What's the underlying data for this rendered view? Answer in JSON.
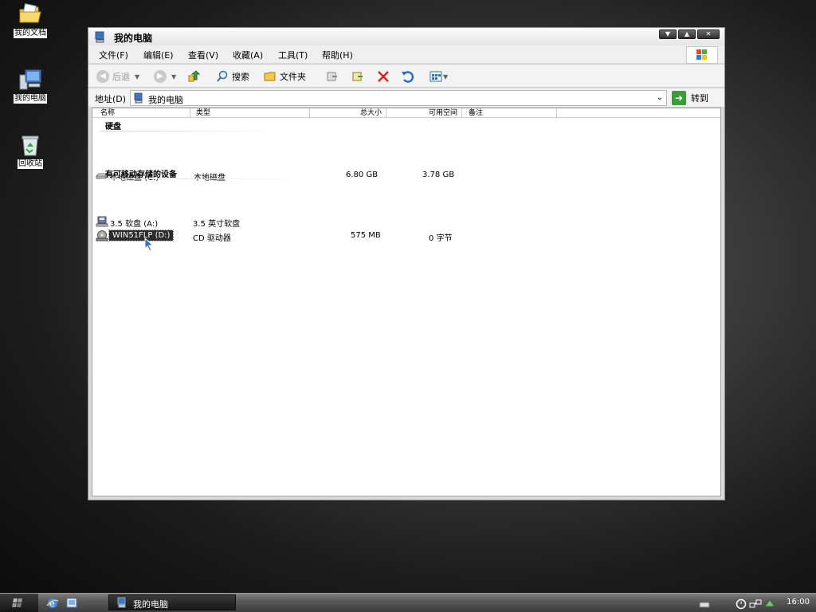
{
  "desktop": {
    "icons": [
      {
        "label": "我的文档"
      },
      {
        "label": "我的电脑"
      },
      {
        "label": "回收站"
      }
    ]
  },
  "window": {
    "title": "我的电脑",
    "buttons": {
      "minimize": "▼",
      "maximize": "▲",
      "close": "✕"
    }
  },
  "menu": [
    "文件(F)",
    "编辑(E)",
    "查看(V)",
    "收藏(A)",
    "工具(T)",
    "帮助(H)"
  ],
  "toolbar": {
    "back": "后退",
    "search": "搜索",
    "folders": "文件夹"
  },
  "address": {
    "label": "地址(D)",
    "value": "我的电脑",
    "go": "转到"
  },
  "columns": [
    "名称",
    "类型",
    "总大小",
    "可用空间",
    "备注"
  ],
  "groups": [
    {
      "name": "硬盘",
      "items": [
        {
          "name": "本地磁盘 (C:)",
          "type": "本地磁盘",
          "total": "6.80 GB",
          "free": "3.78 GB",
          "icon": "hard-drive-icon"
        }
      ]
    },
    {
      "name": "有可移动存储的设备",
      "items": [
        {
          "name": "3.5 软盘 (A:)",
          "type": "3.5 英寸软盘",
          "total": "",
          "free": "",
          "icon": "floppy-drive-icon"
        },
        {
          "name": "WIN51FLP (D:)",
          "type": "CD 驱动器",
          "total": "575 MB",
          "free": "0 字节",
          "icon": "cd-drive-icon",
          "selected": true
        }
      ]
    }
  ],
  "taskbar": {
    "task_label": "我的电脑",
    "clock": "16:00"
  }
}
